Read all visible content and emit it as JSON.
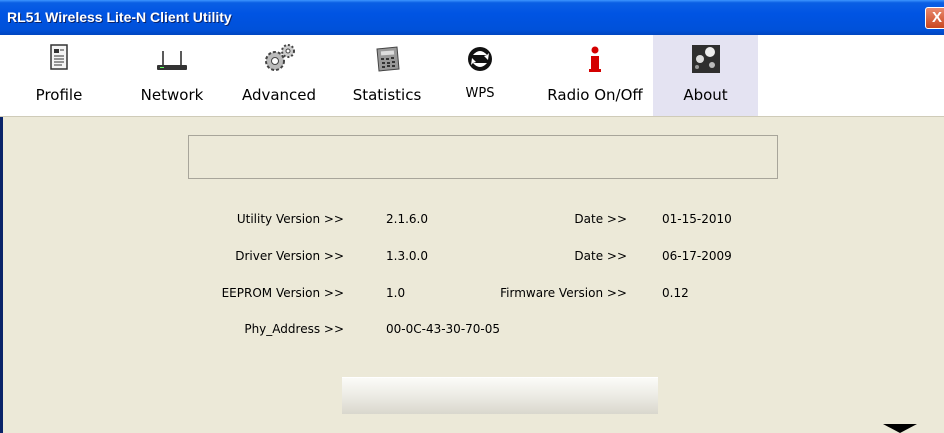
{
  "window": {
    "title": "RL51 Wireless Lite-N Client Utility",
    "close_glyph": "X"
  },
  "toolbar": {
    "items": [
      {
        "label": "Profile",
        "icon": "profile-icon"
      },
      {
        "label": "Network",
        "icon": "network-icon"
      },
      {
        "label": "Advanced",
        "icon": "advanced-icon"
      },
      {
        "label": "Statistics",
        "icon": "statistics-icon"
      },
      {
        "label": "WPS",
        "icon": "wps-icon"
      },
      {
        "label": "Radio On/Off",
        "icon": "radio-icon"
      },
      {
        "label": "About",
        "icon": "about-icon",
        "active": true
      }
    ]
  },
  "about": {
    "utility_version_label": "Utility Version >>",
    "utility_version": "2.1.6.0",
    "utility_date_label": "Date >>",
    "utility_date": "01-15-2010",
    "driver_version_label": "Driver Version >>",
    "driver_version": "1.3.0.0",
    "driver_date_label": "Date >>",
    "driver_date": "06-17-2009",
    "eeprom_version_label": "EEPROM Version >>",
    "eeprom_version": "1.0",
    "firmware_version_label": "Firmware Version >>",
    "firmware_version": "0.12",
    "phy_address_label": "Phy_Address >>",
    "phy_address": "00-0C-43-30-70-05"
  },
  "colors": {
    "titlebar": "#0054e3",
    "window_bg": "#ece9d8",
    "toolbar_bg": "#ffffff",
    "active_tab_bg": "#e4e3f2",
    "radio_icon": "#d40000"
  }
}
